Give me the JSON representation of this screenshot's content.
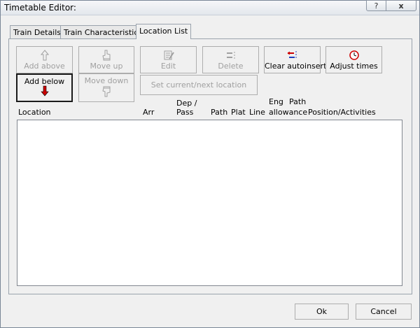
{
  "window": {
    "title": "Timetable Editor:"
  },
  "titlebar": {
    "help_label": "?",
    "close_label": "x"
  },
  "tabs": [
    {
      "label": "Train Details",
      "active": false
    },
    {
      "label": "Train Characteristics",
      "active": false
    },
    {
      "label": "Location List",
      "active": true
    }
  ],
  "toolbar": {
    "add_above": {
      "label": "Add above",
      "icon": "arrow-up-outline-icon",
      "enabled": false
    },
    "move_up": {
      "label": "Move up",
      "icon": "hand-up-icon",
      "enabled": false
    },
    "edit": {
      "label": "Edit",
      "icon": "edit-document-icon",
      "enabled": false
    },
    "delete": {
      "label": "Delete",
      "icon": "delete-lines-icon",
      "enabled": false
    },
    "clear_autoinsert": {
      "label": "Clear autoinsert",
      "icon": "autoinsert-lines-icon",
      "enabled": true
    },
    "adjust_times": {
      "label": "Adjust times",
      "icon": "clock-icon",
      "enabled": true
    },
    "add_below": {
      "label": "Add below",
      "icon": "arrow-down-red-icon",
      "enabled": true
    },
    "move_down": {
      "label": "Move down",
      "icon": "hand-down-icon",
      "enabled": false
    },
    "set_current": {
      "label": "Set current/next location",
      "enabled": false
    }
  },
  "columns": {
    "location": "Location",
    "arr": "Arr",
    "dep_pass_1": "Dep /",
    "dep_pass_2": "Pass",
    "path": "Path",
    "plat": "Plat",
    "line": "Line",
    "eng": "Eng",
    "allowance": "allowance",
    "path_allowance_top": "Path",
    "position_activities": "Position/Activities"
  },
  "locations": [],
  "footer": {
    "ok_label": "Ok",
    "cancel_label": "Cancel"
  },
  "colors": {
    "accent_red": "#cc0000",
    "accent_blue": "#1f3fbf",
    "disabled_text": "#a0a0a0"
  }
}
